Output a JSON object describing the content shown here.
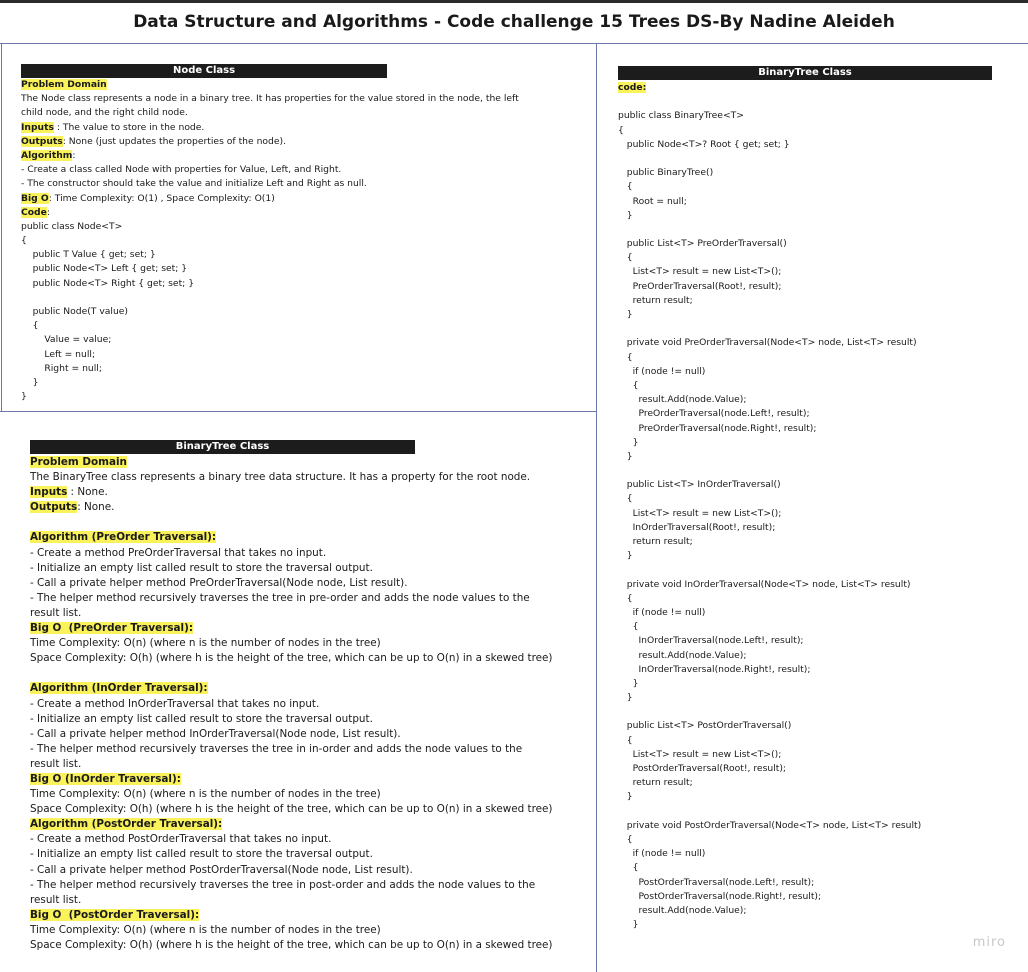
{
  "title": "Data Structure and Algorithms - Code challenge 15  Trees DS-By Nadine Aleideh",
  "watermark": "miro",
  "node_panel": {
    "header": "Node Class",
    "lines": [
      {
        "hl": "Problem Domain",
        "text": ""
      },
      {
        "hl": "",
        "text": "The Node class represents a node in a binary tree. It has properties for the value stored in the node, the left"
      },
      {
        "hl": "",
        "text": "child node, and the right child node."
      },
      {
        "hl": "Inputs",
        "text": " : The value to store in the node."
      },
      {
        "hl": "Outputs",
        "text": ": None (just updates the properties of the node)."
      },
      {
        "hl": "Algorithm",
        "text": ":"
      },
      {
        "hl": "",
        "text": "- Create a class called Node with properties for Value, Left, and Right."
      },
      {
        "hl": "",
        "text": "- The constructor should take the value and initialize Left and Right as null."
      },
      {
        "hl": "Big O",
        "text": ": Time Complexity: O(1) , Space Complexity: O(1)"
      },
      {
        "hl": "Code",
        "text": ":"
      },
      {
        "hl": "",
        "text": "public class Node<T>"
      },
      {
        "hl": "",
        "text": "{"
      },
      {
        "hl": "",
        "text": "    public T Value { get; set; }"
      },
      {
        "hl": "",
        "text": "    public Node<T> Left { get; set; }"
      },
      {
        "hl": "",
        "text": "    public Node<T> Right { get; set; }"
      },
      {
        "hl": "",
        "text": ""
      },
      {
        "hl": "",
        "text": "    public Node(T value)"
      },
      {
        "hl": "",
        "text": "    {"
      },
      {
        "hl": "",
        "text": "        Value = value;"
      },
      {
        "hl": "",
        "text": "        Left = null;"
      },
      {
        "hl": "",
        "text": "        Right = null;"
      },
      {
        "hl": "",
        "text": "    }"
      },
      {
        "hl": "",
        "text": "}"
      }
    ]
  },
  "tree_panel": {
    "header": "BinaryTree Class",
    "lines": [
      {
        "hl": "Problem Domain",
        "text": ""
      },
      {
        "hl": "",
        "text": "The BinaryTree class represents a binary tree data structure. It has a property for the root node."
      },
      {
        "hl": "Inputs",
        "text": " : None."
      },
      {
        "hl": "Outputs",
        "text": ": None."
      },
      {
        "hl": "",
        "text": ""
      },
      {
        "hl": "Algorithm (PreOrder Traversal):",
        "text": ""
      },
      {
        "hl": "",
        "text": "- Create a method PreOrderTraversal that takes no input."
      },
      {
        "hl": "",
        "text": "- Initialize an empty list called result to store the traversal output."
      },
      {
        "hl": "",
        "text": "- Call a private helper method PreOrderTraversal(Node node, List result)."
      },
      {
        "hl": "",
        "text": "- The helper method recursively traverses the tree in pre-order and adds the node values to the"
      },
      {
        "hl": "",
        "text": "result list."
      },
      {
        "hl": "Big O  (PreOrder Traversal):",
        "text": ""
      },
      {
        "hl": "",
        "text": "Time Complexity: O(n) (where n is the number of nodes in the tree)"
      },
      {
        "hl": "",
        "text": "Space Complexity: O(h) (where h is the height of the tree, which can be up to O(n) in a skewed tree)"
      },
      {
        "hl": "",
        "text": ""
      },
      {
        "hl": "Algorithm (InOrder Traversal):",
        "text": ""
      },
      {
        "hl": "",
        "text": "- Create a method InOrderTraversal that takes no input."
      },
      {
        "hl": "",
        "text": "- Initialize an empty list called result to store the traversal output."
      },
      {
        "hl": "",
        "text": "- Call a private helper method InOrderTraversal(Node node, List result)."
      },
      {
        "hl": "",
        "text": "- The helper method recursively traverses the tree in in-order and adds the node values to the"
      },
      {
        "hl": "",
        "text": "result list."
      },
      {
        "hl": "Big O (InOrder Traversal):",
        "text": ""
      },
      {
        "hl": "",
        "text": "Time Complexity: O(n) (where n is the number of nodes in the tree)"
      },
      {
        "hl": "",
        "text": "Space Complexity: O(h) (where h is the height of the tree, which can be up to O(n) in a skewed tree)"
      },
      {
        "hl": "Algorithm (PostOrder Traversal):",
        "text": ""
      },
      {
        "hl": "",
        "text": "- Create a method PostOrderTraversal that takes no input."
      },
      {
        "hl": "",
        "text": "- Initialize an empty list called result to store the traversal output."
      },
      {
        "hl": "",
        "text": "- Call a private helper method PostOrderTraversal(Node node, List result)."
      },
      {
        "hl": "",
        "text": "- The helper method recursively traverses the tree in post-order and adds the node values to the"
      },
      {
        "hl": "",
        "text": "result list."
      },
      {
        "hl": "Big O  (PostOrder Traversal):",
        "text": ""
      },
      {
        "hl": "",
        "text": "Time Complexity: O(n) (where n is the number of nodes in the tree)"
      },
      {
        "hl": "",
        "text": "Space Complexity: O(h) (where h is the height of the tree, which can be up to O(n) in a skewed tree)"
      }
    ]
  },
  "code_panel": {
    "header": "BinaryTree Class",
    "lines": [
      {
        "hl": "code:",
        "text": ""
      },
      {
        "hl": "",
        "text": ""
      },
      {
        "hl": "",
        "text": "public class BinaryTree<T>"
      },
      {
        "hl": "",
        "text": "{"
      },
      {
        "hl": "",
        "text": "   public Node<T>? Root { get; set; }"
      },
      {
        "hl": "",
        "text": ""
      },
      {
        "hl": "",
        "text": "   public BinaryTree()"
      },
      {
        "hl": "",
        "text": "   {"
      },
      {
        "hl": "",
        "text": "     Root = null;"
      },
      {
        "hl": "",
        "text": "   }"
      },
      {
        "hl": "",
        "text": ""
      },
      {
        "hl": "",
        "text": "   public List<T> PreOrderTraversal()"
      },
      {
        "hl": "",
        "text": "   {"
      },
      {
        "hl": "",
        "text": "     List<T> result = new List<T>();"
      },
      {
        "hl": "",
        "text": "     PreOrderTraversal(Root!, result);"
      },
      {
        "hl": "",
        "text": "     return result;"
      },
      {
        "hl": "",
        "text": "   }"
      },
      {
        "hl": "",
        "text": ""
      },
      {
        "hl": "",
        "text": "   private void PreOrderTraversal(Node<T> node, List<T> result)"
      },
      {
        "hl": "",
        "text": "   {"
      },
      {
        "hl": "",
        "text": "     if (node != null)"
      },
      {
        "hl": "",
        "text": "     {"
      },
      {
        "hl": "",
        "text": "       result.Add(node.Value);"
      },
      {
        "hl": "",
        "text": "       PreOrderTraversal(node.Left!, result);"
      },
      {
        "hl": "",
        "text": "       PreOrderTraversal(node.Right!, result);"
      },
      {
        "hl": "",
        "text": "     }"
      },
      {
        "hl": "",
        "text": "   }"
      },
      {
        "hl": "",
        "text": ""
      },
      {
        "hl": "",
        "text": "   public List<T> InOrderTraversal()"
      },
      {
        "hl": "",
        "text": "   {"
      },
      {
        "hl": "",
        "text": "     List<T> result = new List<T>();"
      },
      {
        "hl": "",
        "text": "     InOrderTraversal(Root!, result);"
      },
      {
        "hl": "",
        "text": "     return result;"
      },
      {
        "hl": "",
        "text": "   }"
      },
      {
        "hl": "",
        "text": ""
      },
      {
        "hl": "",
        "text": "   private void InOrderTraversal(Node<T> node, List<T> result)"
      },
      {
        "hl": "",
        "text": "   {"
      },
      {
        "hl": "",
        "text": "     if (node != null)"
      },
      {
        "hl": "",
        "text": "     {"
      },
      {
        "hl": "",
        "text": "       InOrderTraversal(node.Left!, result);"
      },
      {
        "hl": "",
        "text": "       result.Add(node.Value);"
      },
      {
        "hl": "",
        "text": "       InOrderTraversal(node.Right!, result);"
      },
      {
        "hl": "",
        "text": "     }"
      },
      {
        "hl": "",
        "text": "   }"
      },
      {
        "hl": "",
        "text": ""
      },
      {
        "hl": "",
        "text": "   public List<T> PostOrderTraversal()"
      },
      {
        "hl": "",
        "text": "   {"
      },
      {
        "hl": "",
        "text": "     List<T> result = new List<T>();"
      },
      {
        "hl": "",
        "text": "     PostOrderTraversal(Root!, result);"
      },
      {
        "hl": "",
        "text": "     return result;"
      },
      {
        "hl": "",
        "text": "   }"
      },
      {
        "hl": "",
        "text": ""
      },
      {
        "hl": "",
        "text": "   private void PostOrderTraversal(Node<T> node, List<T> result)"
      },
      {
        "hl": "",
        "text": "   {"
      },
      {
        "hl": "",
        "text": "     if (node != null)"
      },
      {
        "hl": "",
        "text": "     {"
      },
      {
        "hl": "",
        "text": "       PostOrderTraversal(node.Left!, result);"
      },
      {
        "hl": "",
        "text": "       PostOrderTraversal(node.Right!, result);"
      },
      {
        "hl": "",
        "text": "       result.Add(node.Value);"
      },
      {
        "hl": "",
        "text": "     }"
      }
    ]
  }
}
